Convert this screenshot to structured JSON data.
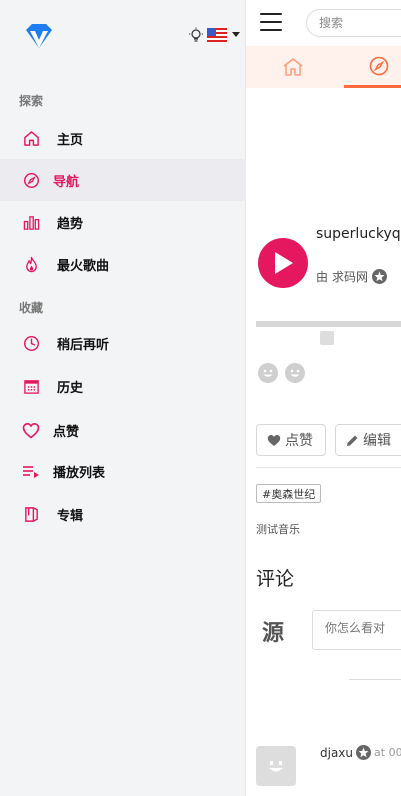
{
  "sidebar": {
    "explore_title": "探索",
    "collect_title": "收藏",
    "items": [
      {
        "label": "主页",
        "icon": "home-icon"
      },
      {
        "label": "导航",
        "icon": "compass-icon"
      },
      {
        "label": "趋势",
        "icon": "bar-chart-icon"
      },
      {
        "label": "最火歌曲",
        "icon": "flame-icon"
      },
      {
        "label": "稍后再听",
        "icon": "clock-icon"
      },
      {
        "label": "历史",
        "icon": "calendar-icon"
      },
      {
        "label": "点赞",
        "icon": "heart-icon"
      },
      {
        "label": "播放列表",
        "icon": "playlist-icon"
      },
      {
        "label": "专辑",
        "icon": "album-icon"
      }
    ],
    "active_index": 1
  },
  "topbar": {
    "search_placeholder": "搜索"
  },
  "track": {
    "title": "superluckyq",
    "by_label": "由",
    "author": "求码网"
  },
  "actions": {
    "like_label": "点赞",
    "edit_label": "编辑"
  },
  "tag": "#奥森世纪",
  "description": "测试音乐",
  "comments": {
    "title": "评论",
    "source_logo_text": "源",
    "placeholder": "你怎么看对",
    "first_user": "djaxu",
    "first_time": "at 00"
  },
  "colors": {
    "accent": "#e5175e",
    "tab_accent": "#ff6b3d",
    "sidebar_bg": "#f3f4f6"
  }
}
